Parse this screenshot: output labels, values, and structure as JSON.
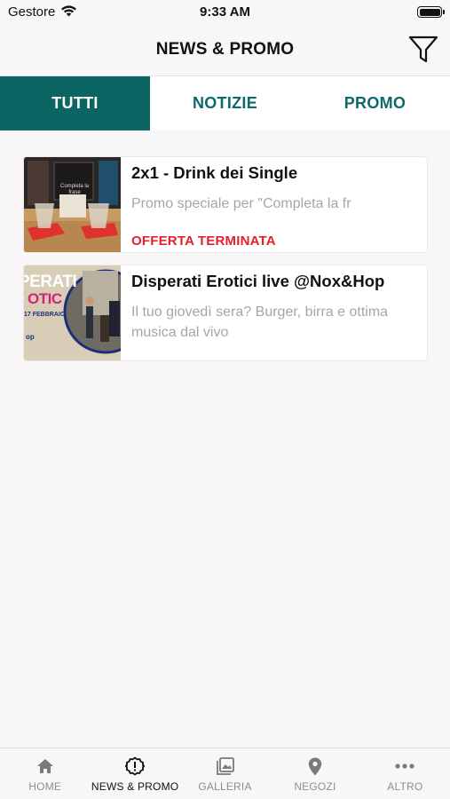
{
  "status_bar": {
    "carrier": "Gestore",
    "time": "9:33 AM"
  },
  "header": {
    "title": "NEWS & PROMO",
    "filter_icon": "filter-funnel-icon"
  },
  "tabs": [
    {
      "label": "TUTTI",
      "active": true
    },
    {
      "label": "NOTIZIE",
      "active": false
    },
    {
      "label": "PROMO",
      "active": false
    }
  ],
  "items": [
    {
      "title": "2x1 - Drink dei Single",
      "description": "Promo speciale per \"Completa la fr",
      "status": "OFFERTA TERMINATA",
      "thumbnail_text": "Completa la frase"
    },
    {
      "title": "Disperati Erotici live @Nox&Hop",
      "description": "Il tuo giovedì sera? Burger, birra e ottima musica dal vivo",
      "thumbnail_text": {
        "line1": "PERATI",
        "line2": "OTIC",
        "date": "17 FEBBRAIO",
        "tag": "op"
      }
    }
  ],
  "colors": {
    "accent": "#0b6563",
    "alert": "#e4202a",
    "muted": "#a6a6a6"
  },
  "tab_bar": [
    {
      "label": "HOME",
      "icon": "home-icon",
      "active": false
    },
    {
      "label": "NEWS & PROMO",
      "icon": "alert-badge-icon",
      "active": true
    },
    {
      "label": "GALLERIA",
      "icon": "gallery-icon",
      "active": false
    },
    {
      "label": "NEGOZI",
      "icon": "location-pin-icon",
      "active": false
    },
    {
      "label": "ALTRO",
      "icon": "more-dots-icon",
      "active": false
    }
  ]
}
